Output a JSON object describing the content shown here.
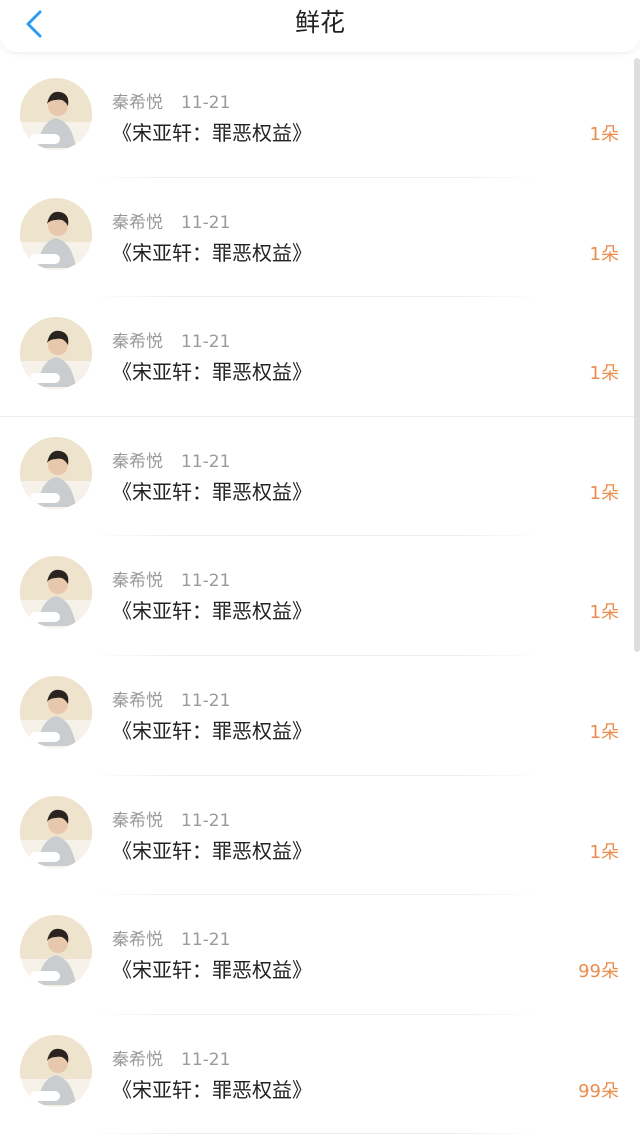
{
  "header": {
    "title": "鲜花",
    "back_icon": "chevron-left-icon",
    "accent_color": "#2b9bf4"
  },
  "accent": {
    "count_color": "#ec8c4c"
  },
  "items": [
    {
      "user": "秦希悦",
      "date": "11-21",
      "book": "《宋亚轩：罪恶权益》",
      "count": "1朵"
    },
    {
      "user": "秦希悦",
      "date": "11-21",
      "book": "《宋亚轩：罪恶权益》",
      "count": "1朵"
    },
    {
      "user": "秦希悦",
      "date": "11-21",
      "book": "《宋亚轩：罪恶权益》",
      "count": "1朵"
    },
    {
      "user": "秦希悦",
      "date": "11-21",
      "book": "《宋亚轩：罪恶权益》",
      "count": "1朵"
    },
    {
      "user": "秦希悦",
      "date": "11-21",
      "book": "《宋亚轩：罪恶权益》",
      "count": "1朵"
    },
    {
      "user": "秦希悦",
      "date": "11-21",
      "book": "《宋亚轩：罪恶权益》",
      "count": "1朵"
    },
    {
      "user": "秦希悦",
      "date": "11-21",
      "book": "《宋亚轩：罪恶权益》",
      "count": "1朵"
    },
    {
      "user": "秦希悦",
      "date": "11-21",
      "book": "《宋亚轩：罪恶权益》",
      "count": "99朵"
    },
    {
      "user": "秦希悦",
      "date": "11-21",
      "book": "《宋亚轩：罪恶权益》",
      "count": "99朵"
    }
  ]
}
